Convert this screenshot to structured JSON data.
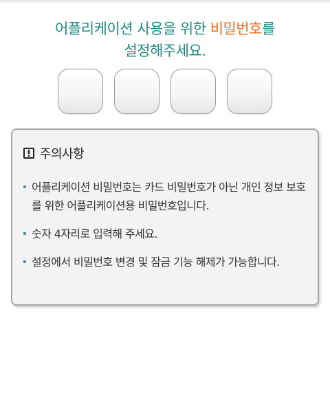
{
  "heading": {
    "line1_before": "어플리케이션 사용을 위한 ",
    "line1_highlight": "비밀번호",
    "line1_after": "를",
    "line2": "설정해주세요.",
    "text_color": "#1f8a86",
    "highlight_color": "#ef6b1f"
  },
  "pin": {
    "digits": [
      "",
      "",
      "",
      ""
    ]
  },
  "notice": {
    "icon": "warning-icon",
    "title": "주의사항",
    "items": [
      {
        "text": "어플리케이션 비밀번호는 카드 비밀번호가 아닌 개인 정보 보호를 위한 어플리케이션용 비밀번호입니다."
      },
      {
        "text": "숫자 4자리로 입력해 주세요."
      },
      {
        "text": "설정에서 비밀번호 변경 및 잠금 기능 해제가 가능합니다."
      }
    ]
  }
}
